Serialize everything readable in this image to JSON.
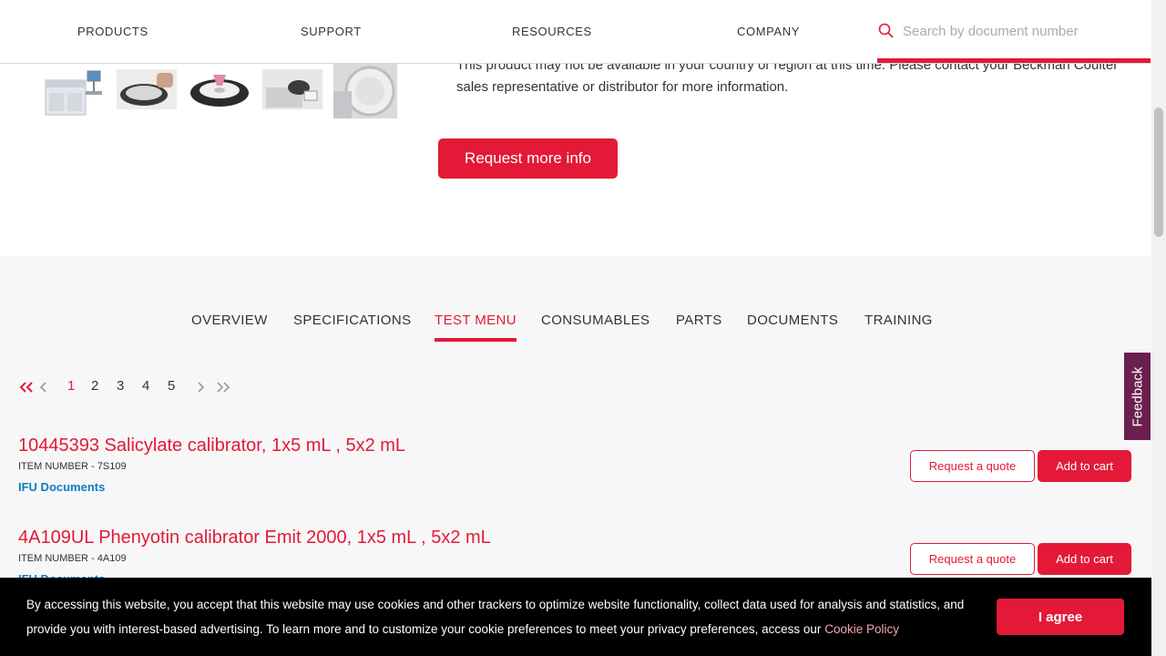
{
  "header": {
    "nav": [
      {
        "label": "PRODUCTS"
      },
      {
        "label": "SUPPORT"
      },
      {
        "label": "RESOURCES"
      },
      {
        "label": "COMPANY"
      }
    ],
    "search": {
      "placeholder": "Search by document number",
      "value": ""
    }
  },
  "product": {
    "availability_note": "This product may not be available in your country or region at this time. Please contact your Beckman Coulter sales representative or distributor for more information.",
    "request_info_label": "Request more info",
    "thumbnails": [
      "analyzer-photo",
      "sample-carousel-photo",
      "reagent-wheel-photo",
      "operator-photo",
      "reaction-disk-photo"
    ]
  },
  "tabs": [
    {
      "label": "OVERVIEW"
    },
    {
      "label": "SPECIFICATIONS"
    },
    {
      "label": "TEST MENU",
      "active": true
    },
    {
      "label": "CONSUMABLES"
    },
    {
      "label": "PARTS"
    },
    {
      "label": "DOCUMENTS"
    },
    {
      "label": "TRAINING"
    }
  ],
  "pagination": {
    "first": "«",
    "prev": "‹",
    "pages": [
      "1",
      "2",
      "3",
      "4",
      "5"
    ],
    "current": "1",
    "next": "›",
    "last": "»"
  },
  "items": [
    {
      "title": "10445393 Salicylate calibrator, 1x5 mL , 5x2 mL",
      "item_number": "ITEM NUMBER - 7S109",
      "ifu_label": "IFU Documents",
      "quote_label": "Request a quote",
      "cart_label": "Add to cart"
    },
    {
      "title": "4A109UL Phenyotin calibrator Emit 2000, 1x5 mL , 5x2 mL",
      "item_number": "ITEM NUMBER - 4A109",
      "ifu_label": "IFU Documents",
      "quote_label": "Request a quote",
      "cart_label": "Add to cart"
    }
  ],
  "feedback_label": "Feedback",
  "cookie": {
    "text": "By accessing this website, you accept that this website may use cookies and other trackers to optimize website functionality, collect data used for analysis and statistics, and provide you with interest-based advertising. To learn more and to customize your cookie preferences to meet your privacy preferences, access our",
    "link_label": "Cookie Policy",
    "agree_label": "I agree"
  },
  "colors": {
    "accent": "#e31937",
    "link": "#0b7dc3",
    "feedback": "#6b1f4f"
  }
}
